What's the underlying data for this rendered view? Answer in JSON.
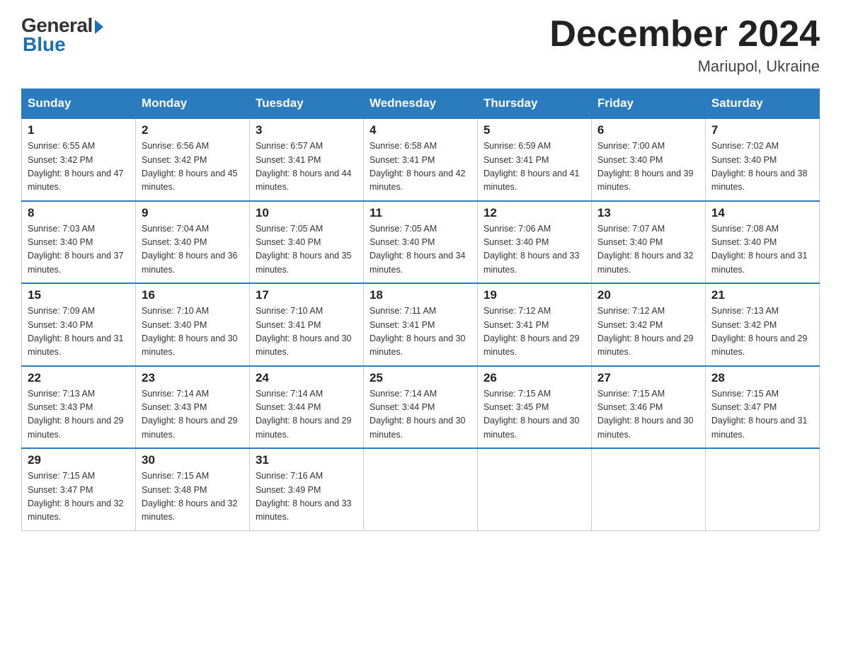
{
  "header": {
    "logo_general": "General",
    "logo_blue": "Blue",
    "month_year": "December 2024",
    "location": "Mariupol, Ukraine"
  },
  "weekdays": [
    "Sunday",
    "Monday",
    "Tuesday",
    "Wednesday",
    "Thursday",
    "Friday",
    "Saturday"
  ],
  "weeks": [
    [
      {
        "day": "1",
        "sunrise": "6:55 AM",
        "sunset": "3:42 PM",
        "daylight": "8 hours and 47 minutes."
      },
      {
        "day": "2",
        "sunrise": "6:56 AM",
        "sunset": "3:42 PM",
        "daylight": "8 hours and 45 minutes."
      },
      {
        "day": "3",
        "sunrise": "6:57 AM",
        "sunset": "3:41 PM",
        "daylight": "8 hours and 44 minutes."
      },
      {
        "day": "4",
        "sunrise": "6:58 AM",
        "sunset": "3:41 PM",
        "daylight": "8 hours and 42 minutes."
      },
      {
        "day": "5",
        "sunrise": "6:59 AM",
        "sunset": "3:41 PM",
        "daylight": "8 hours and 41 minutes."
      },
      {
        "day": "6",
        "sunrise": "7:00 AM",
        "sunset": "3:40 PM",
        "daylight": "8 hours and 39 minutes."
      },
      {
        "day": "7",
        "sunrise": "7:02 AM",
        "sunset": "3:40 PM",
        "daylight": "8 hours and 38 minutes."
      }
    ],
    [
      {
        "day": "8",
        "sunrise": "7:03 AM",
        "sunset": "3:40 PM",
        "daylight": "8 hours and 37 minutes."
      },
      {
        "day": "9",
        "sunrise": "7:04 AM",
        "sunset": "3:40 PM",
        "daylight": "8 hours and 36 minutes."
      },
      {
        "day": "10",
        "sunrise": "7:05 AM",
        "sunset": "3:40 PM",
        "daylight": "8 hours and 35 minutes."
      },
      {
        "day": "11",
        "sunrise": "7:05 AM",
        "sunset": "3:40 PM",
        "daylight": "8 hours and 34 minutes."
      },
      {
        "day": "12",
        "sunrise": "7:06 AM",
        "sunset": "3:40 PM",
        "daylight": "8 hours and 33 minutes."
      },
      {
        "day": "13",
        "sunrise": "7:07 AM",
        "sunset": "3:40 PM",
        "daylight": "8 hours and 32 minutes."
      },
      {
        "day": "14",
        "sunrise": "7:08 AM",
        "sunset": "3:40 PM",
        "daylight": "8 hours and 31 minutes."
      }
    ],
    [
      {
        "day": "15",
        "sunrise": "7:09 AM",
        "sunset": "3:40 PM",
        "daylight": "8 hours and 31 minutes."
      },
      {
        "day": "16",
        "sunrise": "7:10 AM",
        "sunset": "3:40 PM",
        "daylight": "8 hours and 30 minutes."
      },
      {
        "day": "17",
        "sunrise": "7:10 AM",
        "sunset": "3:41 PM",
        "daylight": "8 hours and 30 minutes."
      },
      {
        "day": "18",
        "sunrise": "7:11 AM",
        "sunset": "3:41 PM",
        "daylight": "8 hours and 30 minutes."
      },
      {
        "day": "19",
        "sunrise": "7:12 AM",
        "sunset": "3:41 PM",
        "daylight": "8 hours and 29 minutes."
      },
      {
        "day": "20",
        "sunrise": "7:12 AM",
        "sunset": "3:42 PM",
        "daylight": "8 hours and 29 minutes."
      },
      {
        "day": "21",
        "sunrise": "7:13 AM",
        "sunset": "3:42 PM",
        "daylight": "8 hours and 29 minutes."
      }
    ],
    [
      {
        "day": "22",
        "sunrise": "7:13 AM",
        "sunset": "3:43 PM",
        "daylight": "8 hours and 29 minutes."
      },
      {
        "day": "23",
        "sunrise": "7:14 AM",
        "sunset": "3:43 PM",
        "daylight": "8 hours and 29 minutes."
      },
      {
        "day": "24",
        "sunrise": "7:14 AM",
        "sunset": "3:44 PM",
        "daylight": "8 hours and 29 minutes."
      },
      {
        "day": "25",
        "sunrise": "7:14 AM",
        "sunset": "3:44 PM",
        "daylight": "8 hours and 30 minutes."
      },
      {
        "day": "26",
        "sunrise": "7:15 AM",
        "sunset": "3:45 PM",
        "daylight": "8 hours and 30 minutes."
      },
      {
        "day": "27",
        "sunrise": "7:15 AM",
        "sunset": "3:46 PM",
        "daylight": "8 hours and 30 minutes."
      },
      {
        "day": "28",
        "sunrise": "7:15 AM",
        "sunset": "3:47 PM",
        "daylight": "8 hours and 31 minutes."
      }
    ],
    [
      {
        "day": "29",
        "sunrise": "7:15 AM",
        "sunset": "3:47 PM",
        "daylight": "8 hours and 32 minutes."
      },
      {
        "day": "30",
        "sunrise": "7:15 AM",
        "sunset": "3:48 PM",
        "daylight": "8 hours and 32 minutes."
      },
      {
        "day": "31",
        "sunrise": "7:16 AM",
        "sunset": "3:49 PM",
        "daylight": "8 hours and 33 minutes."
      },
      null,
      null,
      null,
      null
    ]
  ]
}
